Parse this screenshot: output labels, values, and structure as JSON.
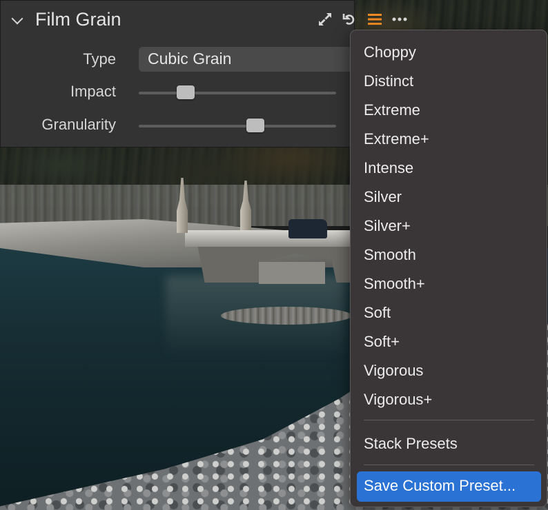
{
  "panel": {
    "title": "Film Grain",
    "type_label": "Type",
    "type_value": "Cubic Grain",
    "impact_label": "Impact",
    "impact_level": 0.21,
    "granularity_label": "Granularity",
    "granularity_level": 0.6,
    "icons": [
      "chevron-down-icon",
      "expand-arrows-icon",
      "reset-undo-icon",
      "presets-menu-icon",
      "more-ellipsis-icon"
    ],
    "accent_color": "#f08a24"
  },
  "menu": {
    "presets": [
      "Choppy",
      "Distinct",
      "Extreme",
      "Extreme+",
      "Intense",
      "Silver",
      "Silver+",
      "Smooth",
      "Smooth+",
      "Soft",
      "Soft+",
      "Vigorous",
      "Vigorous+"
    ],
    "stack_presets": "Stack Presets",
    "save_custom_preset": "Save Custom Preset...",
    "highlight_color": "#2a72d4"
  }
}
